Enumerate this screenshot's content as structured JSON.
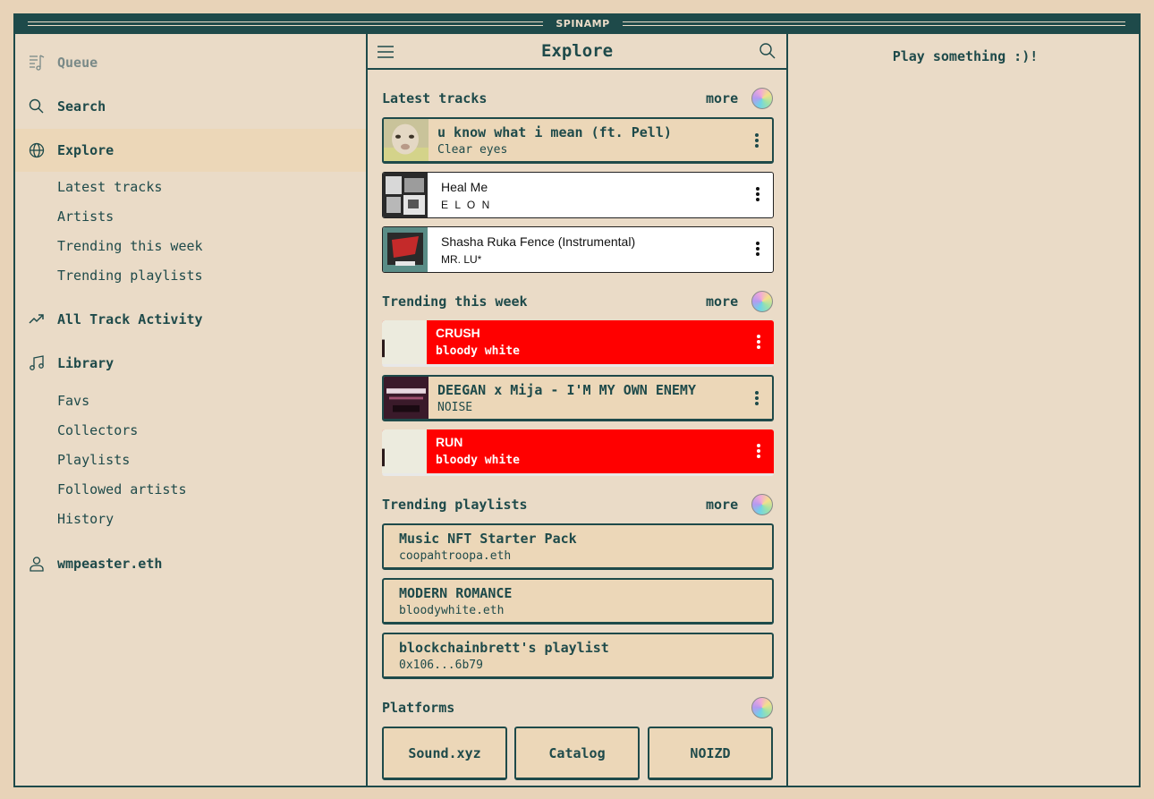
{
  "app": {
    "title": "SPINAMP"
  },
  "sidebar": {
    "queue": "Queue",
    "search": "Search",
    "explore": "Explore",
    "explore_items": [
      "Latest tracks",
      "Artists",
      "Trending this week",
      "Trending playlists"
    ],
    "activity": "All Track Activity",
    "library": "Library",
    "library_items": [
      "Favs",
      "Collectors",
      "Playlists",
      "Followed artists",
      "History"
    ],
    "account": "wmpeaster.eth"
  },
  "main": {
    "heading": "Explore",
    "more_label": "more",
    "latest": {
      "title": "Latest tracks",
      "tracks": [
        {
          "title": "u know what i mean (ft. Pell)",
          "artist": "Clear eyes"
        },
        {
          "title": "Heal Me",
          "artist": "E L O N"
        },
        {
          "title": "Shasha Ruka Fence (Instrumental)",
          "artist": "MR. LU*"
        }
      ]
    },
    "trending": {
      "title": "Trending this week",
      "tracks": [
        {
          "title": "CRUSH",
          "artist": "bloody white"
        },
        {
          "title": "DEEGAN x Mija - I'M MY OWN ENEMY",
          "artist": "NOISE"
        },
        {
          "title": "RUN",
          "artist": "bloody white"
        }
      ]
    },
    "playlists": {
      "title": "Trending playlists",
      "items": [
        {
          "title": "Music NFT Starter Pack",
          "owner": "coopahtroopa.eth"
        },
        {
          "title": "MODERN ROMANCE",
          "owner": "bloodywhite.eth"
        },
        {
          "title": "blockchainbrett's playlist",
          "owner": "0x106...6b79"
        }
      ]
    },
    "platforms": {
      "title": "Platforms",
      "items": [
        "Sound.xyz",
        "Catalog",
        "NOIZD"
      ]
    }
  },
  "player": {
    "empty": "Play something :)!"
  },
  "colors": {
    "accent": "#1e4a4a",
    "background": "#eadbc7",
    "highlight": "#ff0000"
  }
}
